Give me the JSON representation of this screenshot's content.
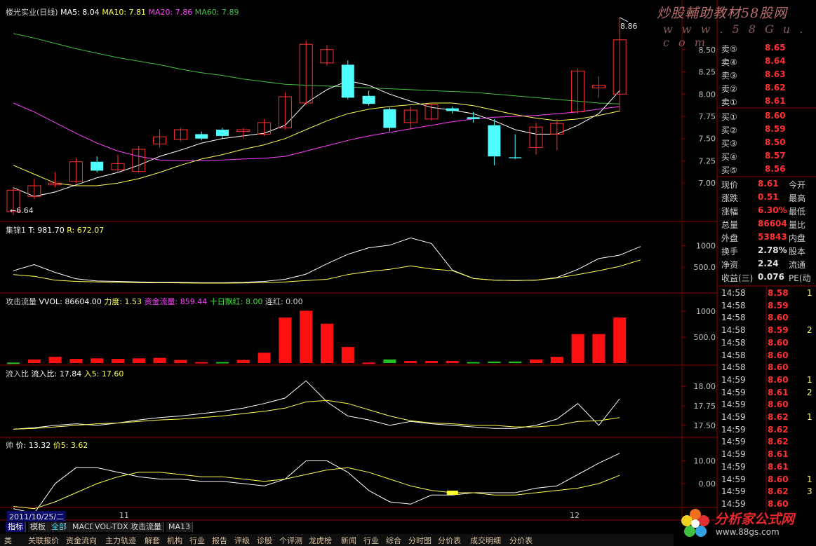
{
  "main_panel": {
    "stock_name": "楼光实业(日线)",
    "ma5_label": "MA5: 8.04",
    "ma10_label": "MA10: 7.81",
    "ma20_label": "MA20: 7.86",
    "ma60_label": "MA60: 7.89",
    "y_ticks": [
      "8.50",
      "8.25",
      "8.00",
      "7.75",
      "7.50",
      "7.25",
      "7.00"
    ],
    "high_marker": "8.86",
    "low_marker": "6.64"
  },
  "indicator_1": {
    "title": "集锦1",
    "t_label": "T: 981.70",
    "r_label": "R: 672.07",
    "y_ticks": [
      "1000",
      "500.0"
    ]
  },
  "indicator_2": {
    "title": "攻击流量",
    "vvol_label": "VVOL: 86604.00",
    "force_label": "力度: 1.53",
    "fund_label": "资金流量: 859.44",
    "red_label": "十日飘红: 8.00",
    "streak_label": "连红: 0.00",
    "y_ticks": [
      "1000",
      "500.0"
    ]
  },
  "indicator_3": {
    "title": "流入比",
    "ratio_label": "流入比: 17.84",
    "in5_label": "入5: 17.60",
    "y_ticks": [
      "18.00",
      "17.75",
      "17.50"
    ]
  },
  "indicator_4": {
    "title": "帅",
    "price_label": "价: 13.32",
    "price5_label": "价5: 3.62",
    "y_ticks": [
      "10.00",
      "0.00"
    ]
  },
  "x_axis": {
    "date_label": "2011/10/25/二",
    "month_11": "11",
    "month_12": "12"
  },
  "tabs": [
    "指标",
    "模板",
    "全部",
    "MACD",
    "VOL-TDX",
    "攻击流量",
    "MA13"
  ],
  "bottom_bar": [
    "类",
    "关联报价",
    "资金流向",
    "主力轨迹",
    "解套",
    "机构",
    "行业",
    "报告",
    "评级",
    "诊股",
    "个评测",
    "龙虎榜",
    "新闻",
    "行业",
    "综合",
    "分时图",
    "分价表",
    "成交明细",
    "分价表"
  ],
  "order_book": {
    "sell": [
      {
        "label": "卖⑤",
        "price": "8.65"
      },
      {
        "label": "卖④",
        "price": "8.64"
      },
      {
        "label": "卖③",
        "price": "8.63"
      },
      {
        "label": "卖②",
        "price": "8.62"
      },
      {
        "label": "卖①",
        "price": "8.61"
      }
    ],
    "buy": [
      {
        "label": "买①",
        "price": "8.60"
      },
      {
        "label": "买②",
        "price": "8.59"
      },
      {
        "label": "买③",
        "price": "8.50"
      },
      {
        "label": "买④",
        "price": "8.57"
      },
      {
        "label": "买⑤",
        "price": "8.56"
      }
    ]
  },
  "quote": [
    {
      "label": "现价",
      "value": "8.61",
      "right": "今开"
    },
    {
      "label": "涨跌",
      "value": "0.51",
      "right": "最高"
    },
    {
      "label": "涨幅",
      "value": "6.30%",
      "right": "最低"
    },
    {
      "label": "总量",
      "value": "86604",
      "right": "量比"
    },
    {
      "label": "外盘",
      "value": "53843",
      "right": "内盘"
    },
    {
      "label": "换手",
      "value": "2.78%",
      "right": "股本"
    },
    {
      "label": "净资",
      "value": "2.24",
      "right": "流通"
    },
    {
      "label": "收益(三)",
      "value": "0.076",
      "right": "PE(动"
    }
  ],
  "ticks": [
    {
      "time": "14:58",
      "price": "8.58",
      "vol": "1"
    },
    {
      "time": "14:58",
      "price": "8.59",
      "vol": ""
    },
    {
      "time": "14:58",
      "price": "8.60",
      "vol": ""
    },
    {
      "time": "14:58",
      "price": "8.59",
      "vol": "2"
    },
    {
      "time": "14:58",
      "price": "8.60",
      "vol": ""
    },
    {
      "time": "14:58",
      "price": "8.60",
      "vol": ""
    },
    {
      "time": "14:58",
      "price": "8.60",
      "vol": ""
    },
    {
      "time": "14:59",
      "price": "8.60",
      "vol": "1"
    },
    {
      "time": "14:59",
      "price": "8.61",
      "vol": "2"
    },
    {
      "time": "14:59",
      "price": "8.60",
      "vol": ""
    },
    {
      "time": "14:59",
      "price": "8.62",
      "vol": "1"
    },
    {
      "time": "14:59",
      "price": "8.62",
      "vol": ""
    },
    {
      "time": "14:59",
      "price": "8.62",
      "vol": ""
    },
    {
      "time": "14:59",
      "price": "8.61",
      "vol": ""
    },
    {
      "time": "14:59",
      "price": "8.61",
      "vol": ""
    },
    {
      "time": "14:59",
      "price": "8.60",
      "vol": "1"
    },
    {
      "time": "14:59",
      "price": "8.62",
      "vol": "3"
    },
    {
      "time": "14:59",
      "price": "8.60",
      "vol": ""
    }
  ],
  "watermark_top": {
    "text": "炒股輔助教材58股网",
    "url": "w w w . 5 8 G u . c o m"
  },
  "watermark_bottom": {
    "text": "分析家公式网",
    "url": "www.88gs.com"
  },
  "colors": {
    "up": "#ff3030",
    "down": "#50ffff",
    "ma5": "#ffffff",
    "ma10": "#ffff50",
    "ma20": "#ff40ff",
    "ma60": "#40c040",
    "grid": "#8b0000",
    "axis_text": "#c0c0c0"
  },
  "chart_data": {
    "type": "candlestick",
    "title": "楼光实业(日线)",
    "candles": [
      {
        "o": 6.68,
        "h": 6.95,
        "l": 6.64,
        "c": 6.92
      },
      {
        "o": 6.85,
        "h": 7.05,
        "l": 6.82,
        "c": 6.97
      },
      {
        "o": 6.98,
        "h": 7.12,
        "l": 6.95,
        "c": 7.0
      },
      {
        "o": 7.02,
        "h": 7.28,
        "l": 7.0,
        "c": 7.24
      },
      {
        "o": 7.24,
        "h": 7.3,
        "l": 7.12,
        "c": 7.14
      },
      {
        "o": 7.15,
        "h": 7.32,
        "l": 7.13,
        "c": 7.22
      },
      {
        "o": 7.13,
        "h": 7.42,
        "l": 7.12,
        "c": 7.38
      },
      {
        "o": 7.44,
        "h": 7.6,
        "l": 7.4,
        "c": 7.52
      },
      {
        "o": 7.49,
        "h": 7.62,
        "l": 7.47,
        "c": 7.6
      },
      {
        "o": 7.55,
        "h": 7.58,
        "l": 7.48,
        "c": 7.5
      },
      {
        "o": 7.6,
        "h": 7.62,
        "l": 7.5,
        "c": 7.53
      },
      {
        "o": 7.58,
        "h": 7.62,
        "l": 7.5,
        "c": 7.6
      },
      {
        "o": 7.55,
        "h": 7.72,
        "l": 7.53,
        "c": 7.68
      },
      {
        "o": 7.62,
        "h": 8.02,
        "l": 7.6,
        "c": 7.97
      },
      {
        "o": 7.9,
        "h": 8.6,
        "l": 7.88,
        "c": 8.56
      },
      {
        "o": 8.35,
        "h": 8.55,
        "l": 8.32,
        "c": 8.5
      },
      {
        "o": 8.33,
        "h": 8.38,
        "l": 7.94,
        "c": 7.96
      },
      {
        "o": 7.98,
        "h": 8.04,
        "l": 7.87,
        "c": 7.89
      },
      {
        "o": 7.83,
        "h": 7.85,
        "l": 7.58,
        "c": 7.62
      },
      {
        "o": 7.68,
        "h": 7.86,
        "l": 7.6,
        "c": 7.82
      },
      {
        "o": 7.72,
        "h": 7.9,
        "l": 7.7,
        "c": 7.88
      },
      {
        "o": 7.84,
        "h": 7.86,
        "l": 7.78,
        "c": 7.81
      },
      {
        "o": 7.74,
        "h": 7.8,
        "l": 7.68,
        "c": 7.72
      },
      {
        "o": 7.65,
        "h": 7.72,
        "l": 7.2,
        "c": 7.3
      },
      {
        "o": 7.29,
        "h": 7.55,
        "l": 7.27,
        "c": 7.28
      },
      {
        "o": 7.4,
        "h": 7.68,
        "l": 7.32,
        "c": 7.63
      },
      {
        "o": 7.55,
        "h": 7.72,
        "l": 7.37,
        "c": 7.67
      },
      {
        "o": 7.8,
        "h": 8.29,
        "l": 7.78,
        "c": 8.26
      },
      {
        "o": 8.07,
        "h": 8.2,
        "l": 7.96,
        "c": 8.1
      },
      {
        "o": 8.0,
        "h": 8.86,
        "l": 7.8,
        "c": 8.61
      }
    ],
    "ma5": [
      6.95,
      6.85,
      6.9,
      6.98,
      7.06,
      7.12,
      7.2,
      7.3,
      7.37,
      7.45,
      7.5,
      7.53,
      7.56,
      7.65,
      7.9,
      8.05,
      8.15,
      8.1,
      8.0,
      7.92,
      7.85,
      7.82,
      7.78,
      7.7,
      7.6,
      7.55,
      7.55,
      7.65,
      7.78,
      8.04
    ],
    "ma10": [
      7.2,
      7.1,
      7.0,
      6.97,
      6.97,
      7.0,
      7.05,
      7.12,
      7.2,
      7.27,
      7.32,
      7.38,
      7.43,
      7.5,
      7.6,
      7.7,
      7.78,
      7.83,
      7.86,
      7.88,
      7.9,
      7.9,
      7.87,
      7.82,
      7.77,
      7.73,
      7.7,
      7.72,
      7.76,
      7.81
    ],
    "ma20": [
      7.9,
      7.8,
      7.68,
      7.56,
      7.45,
      7.36,
      7.3,
      7.26,
      7.25,
      7.25,
      7.26,
      7.27,
      7.28,
      7.3,
      7.36,
      7.42,
      7.48,
      7.53,
      7.57,
      7.61,
      7.65,
      7.69,
      7.72,
      7.74,
      7.75,
      7.76,
      7.78,
      7.8,
      7.83,
      7.86
    ],
    "ma60": [
      8.68,
      8.63,
      8.57,
      8.51,
      8.46,
      8.41,
      8.37,
      8.33,
      8.28,
      8.24,
      8.21,
      8.17,
      8.14,
      8.11,
      8.1,
      8.09,
      8.08,
      8.07,
      8.06,
      8.05,
      8.04,
      8.03,
      8.02,
      8.0,
      7.98,
      7.96,
      7.94,
      7.92,
      7.9,
      7.89
    ],
    "ylim": [
      6.6,
      8.9
    ],
    "jijin_t": [
      420,
      560,
      380,
      230,
      180,
      170,
      160,
      150,
      150,
      140,
      140,
      150,
      170,
      220,
      340,
      580,
      800,
      950,
      1010,
      1180,
      1050,
      430,
      240,
      200,
      190,
      200,
      260,
      450,
      700,
      780,
      980
    ],
    "jijin_r": [
      330,
      290,
      200,
      170,
      160,
      150,
      140,
      140,
      135,
      130,
      130,
      135,
      140,
      160,
      190,
      220,
      330,
      400,
      450,
      530,
      460,
      420,
      240,
      200,
      190,
      200,
      250,
      330,
      420,
      520,
      670
    ],
    "vol_bars": [
      10,
      70,
      120,
      80,
      90,
      80,
      90,
      100,
      60,
      20,
      20,
      60,
      200,
      880,
      1010,
      760,
      310,
      10,
      70,
      40,
      40,
      40,
      20,
      30,
      30,
      70,
      120,
      560,
      560,
      880
    ],
    "vol_colors": [
      "g",
      "r",
      "r",
      "r",
      "r",
      "r",
      "r",
      "r",
      "r",
      "r",
      "g",
      "r",
      "r",
      "r",
      "r",
      "r",
      "r",
      "r",
      "g",
      "r",
      "r",
      "r",
      "g",
      "g",
      "g",
      "r",
      "r",
      "r",
      "r",
      "r"
    ],
    "inflow": [
      17.45,
      17.47,
      17.5,
      17.52,
      17.5,
      17.53,
      17.57,
      17.6,
      17.62,
      17.65,
      17.68,
      17.72,
      17.78,
      17.85,
      18.07,
      17.8,
      17.62,
      17.57,
      17.5,
      17.55,
      17.52,
      17.5,
      17.48,
      17.46,
      17.46,
      17.5,
      17.58,
      17.78,
      17.5,
      17.84
    ],
    "inflow5": [
      17.45,
      17.46,
      17.48,
      17.5,
      17.52,
      17.53,
      17.55,
      17.57,
      17.58,
      17.6,
      17.62,
      17.65,
      17.68,
      17.72,
      17.8,
      17.82,
      17.78,
      17.7,
      17.62,
      17.56,
      17.53,
      17.52,
      17.5,
      17.5,
      17.48,
      17.48,
      17.5,
      17.55,
      17.56,
      17.6
    ],
    "shuai_price": [
      -11,
      -13,
      0,
      7,
      7,
      5,
      3,
      2,
      2,
      1,
      1,
      0,
      -1,
      2,
      10,
      10,
      5,
      -3,
      -8,
      -9,
      -5,
      -5,
      -4,
      -4,
      -4,
      -2,
      -1,
      4,
      9,
      13.32
    ],
    "shuai_price5": [
      -10,
      -11,
      -8,
      -4,
      0,
      3,
      5,
      5,
      4,
      3,
      3,
      2,
      1,
      2,
      4,
      6,
      7,
      5,
      2,
      -1,
      -3,
      -4,
      -4,
      -5,
      -5,
      -4,
      -3,
      -2,
      0,
      3.62
    ]
  }
}
